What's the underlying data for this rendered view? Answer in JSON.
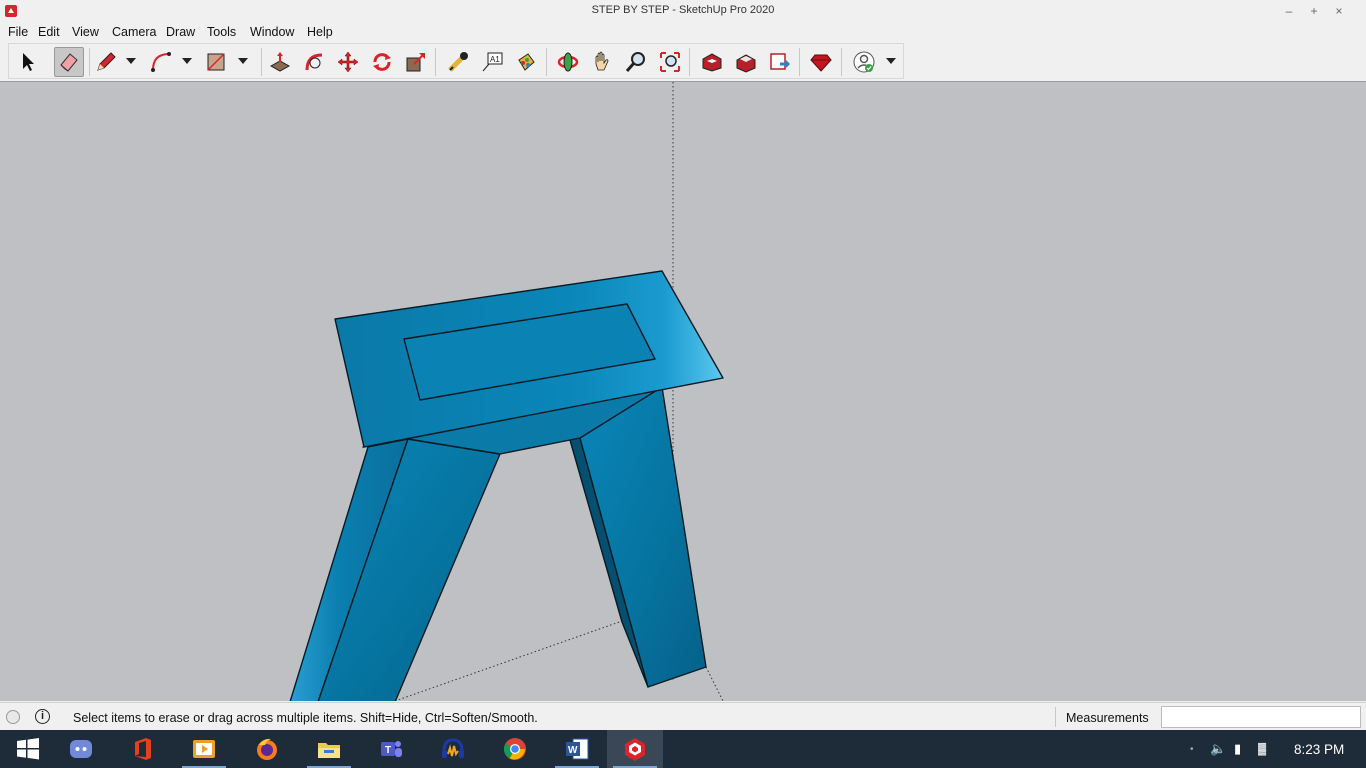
{
  "window": {
    "title": "STEP BY STEP - SketchUp Pro 2020",
    "app_icon": "sketchup-icon",
    "controls": [
      "minimize-icon",
      "maximize-icon",
      "close-icon"
    ]
  },
  "menu": {
    "items": [
      {
        "label": "File"
      },
      {
        "label": "Edit"
      },
      {
        "label": "View"
      },
      {
        "label": "Camera"
      },
      {
        "label": "Draw"
      },
      {
        "label": "Tools"
      },
      {
        "label": "Window"
      },
      {
        "label": "Help"
      }
    ]
  },
  "toolbar": {
    "active_tool": "eraser",
    "tools": [
      "select",
      "eraser",
      "line",
      "arc",
      "rectangle",
      "push-pull",
      "follow-me",
      "move",
      "rotate",
      "scale",
      "tape-measure",
      "text",
      "paint-bucket",
      "orbit",
      "pan",
      "zoom",
      "zoom-extents",
      "3d-warehouse",
      "extension-warehouse",
      "send-to-layout",
      "extension-manager",
      "account"
    ]
  },
  "viewport": {
    "background": "#bfc0c4",
    "model_color": "#0a7fb0"
  },
  "status": {
    "hint": "Select items to erase or drag across multiple items. Shift=Hide, Ctrl=Soften/Smooth.",
    "measurements_label": "Measurements",
    "measurements_value": ""
  },
  "taskbar": {
    "apps": [
      "windows-start",
      "discord",
      "office",
      "video-player",
      "firefox",
      "file-explorer",
      "teams",
      "audacity",
      "chrome",
      "word",
      "sketchup"
    ],
    "active_app": "sketchup",
    "clock": "8:23 PM"
  }
}
